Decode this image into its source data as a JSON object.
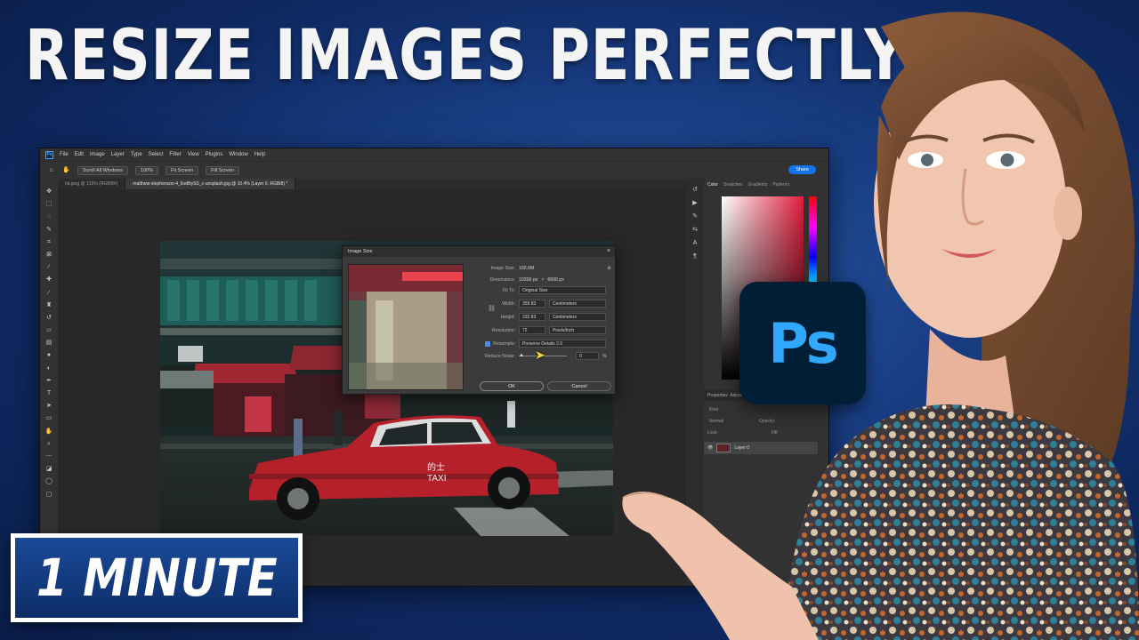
{
  "headline": "RESIZE IMAGES PERFECTLY",
  "badge_minute": "1 MINUTE",
  "ps_badge": "Ps",
  "photoshop": {
    "app_icon": "Ps",
    "menu": [
      "File",
      "Edit",
      "Image",
      "Layer",
      "Type",
      "Select",
      "Filter",
      "View",
      "Plugins",
      "Window",
      "Help"
    ],
    "options": {
      "scroll_all": "Scroll All Windows",
      "zoom": "100%",
      "fit_screen": "Fit Screen",
      "fill_screen": "Fill Screen",
      "share": "Share"
    },
    "tabs": [
      "hit.jpeg @ 133% (RGB/8#)",
      "matthew-stephenson-4_EwBtySS_c-unsplash.jpg @ 10.4% (Layer 0, RGB/8) *"
    ],
    "panels": {
      "tabs": [
        "Color",
        "Swatches",
        "Gradients",
        "Patterns"
      ],
      "layers_tabs": [
        "Properties",
        "Adjust"
      ],
      "kind": "Kind",
      "blend_mode": "Normal",
      "opacity_label": "Opacity:",
      "lock_label": "Lock:",
      "fill_label": "Fill:",
      "layer_name": "Layer 0"
    },
    "photo_sign": "的士\nTAXI",
    "dialog": {
      "title": "Image Size",
      "image_size_label": "Image Size:",
      "image_size_value": "192.6M",
      "dimensions_label": "Dimensions:",
      "dimensions_w": "10200 px",
      "dimensions_x": "×",
      "dimensions_h": "6600 px",
      "fit_to_label": "Fit To:",
      "fit_to_value": "Original Size",
      "width_label": "Width:",
      "width_value": "359.83",
      "width_unit": "Centimeters",
      "height_label": "Height:",
      "height_value": "232.83",
      "height_unit": "Centimeters",
      "resolution_label": "Resolution:",
      "resolution_value": "72",
      "resolution_unit": "Pixels/Inch",
      "resample_label": "Resample:",
      "resample_value": "Preserve Details 2.0",
      "reduce_noise_label": "Reduce Noise:",
      "reduce_noise_value": "0",
      "reduce_noise_unit": "%",
      "ok": "OK",
      "cancel": "Cancel"
    }
  },
  "colors": {
    "ps_blue": "#31a8ff",
    "ps_dark": "#001e36",
    "share_blue": "#1473e6",
    "taxi_red": "#b5202a"
  }
}
